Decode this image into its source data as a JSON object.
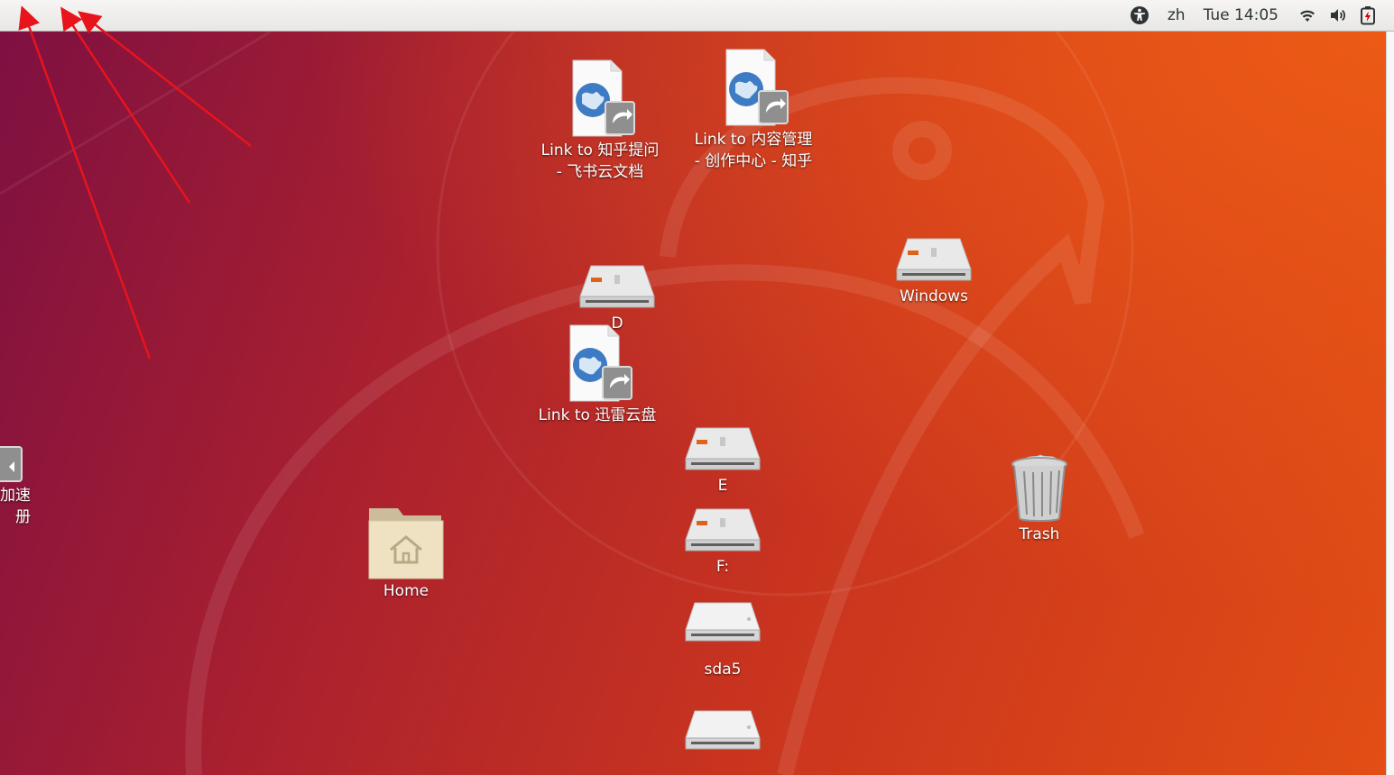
{
  "topbar": {
    "language": "zh",
    "clock": "Tue 14:05",
    "icons": [
      "accessibility-icon",
      "wifi-icon",
      "volume-icon",
      "battery-icon"
    ]
  },
  "desktop_icons": [
    {
      "name": "link-zhihu-question",
      "label": "Link to 知乎提问\n- 飞书云文档",
      "icon": "web-link-icon"
    },
    {
      "name": "link-content-manage",
      "label": "Link to 内容管理\n- 创作中心 - 知乎",
      "icon": "web-link-icon"
    },
    {
      "name": "drive-d",
      "label": "D",
      "icon": "hard-drive-icon"
    },
    {
      "name": "link-xunlei",
      "label": "Link to 迅雷云盘",
      "icon": "web-link-icon"
    },
    {
      "name": "drive-windows",
      "label": "Windows",
      "icon": "hard-drive-icon"
    },
    {
      "name": "drive-e",
      "label": "E",
      "icon": "hard-drive-icon"
    },
    {
      "name": "drive-f",
      "label": "F:",
      "icon": "hard-drive-icon"
    },
    {
      "name": "drive-sda5",
      "label": "sda5",
      "icon": "removable-drive-icon"
    },
    {
      "name": "drive-bottom",
      "label": "",
      "icon": "removable-drive-icon"
    },
    {
      "name": "home-folder",
      "label": "Home",
      "icon": "home-folder-icon"
    },
    {
      "name": "trash",
      "label": "Trash",
      "icon": "trash-icon"
    },
    {
      "name": "partial-left-item",
      "label": "加速\n册",
      "icon": "web-link-icon"
    }
  ],
  "colors": {
    "annotation_arrow": "#e8141b",
    "topbar": "#f0efed"
  }
}
